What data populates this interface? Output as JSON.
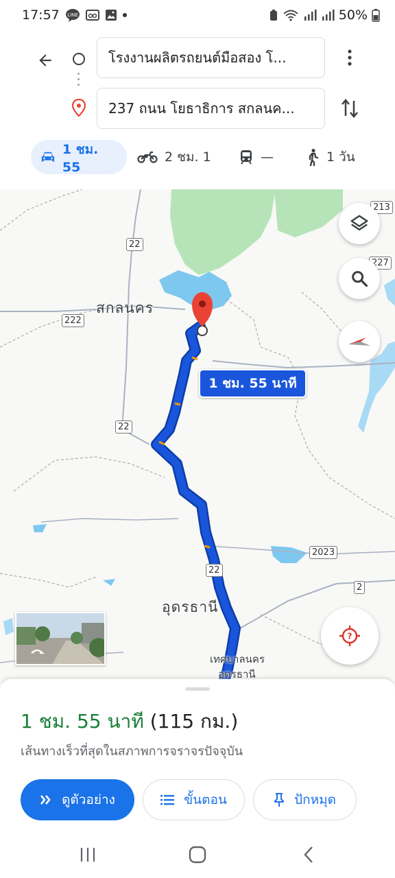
{
  "status_bar": {
    "time": "17:57",
    "battery": "50%",
    "icons": [
      "line-icon",
      "voicemail-icon",
      "gallery-icon",
      "wifi-icon",
      "signal-icon",
      "battery-icon"
    ]
  },
  "directions": {
    "origin": "โรงงานผลิตรถยนต์มือสอง โ...",
    "destination": "237 ถนน โยธาธิการ สกลนค...",
    "modes": [
      {
        "name": "car",
        "label": "1 ชม. 55",
        "active": true
      },
      {
        "name": "motorcycle",
        "label": "2 ชม. 1",
        "active": false
      },
      {
        "name": "transit",
        "label": "—",
        "active": false
      },
      {
        "name": "walk",
        "label": "1 วัน",
        "active": false
      }
    ]
  },
  "map": {
    "city_labels": {
      "sakon": "สกลนคร",
      "udon": "อุดรธานี",
      "municipality_line1": "เทศบาลนคร",
      "municipality_line2": "อุดรธานี"
    },
    "route_shields": [
      "22",
      "222",
      "22",
      "22",
      "2023",
      "2",
      "213",
      "227"
    ],
    "eta_bubble": "1 ชม. 55 นาที",
    "route_color": "#1a56db",
    "destination_pin_color": "#ea4335"
  },
  "sheet": {
    "duration": "1 ชม. 55 นาที",
    "distance": "(115 กม.)",
    "subtitle": "เส้นทางเร็วที่สุดในสภาพการจราจรปัจจุบัน",
    "buttons": {
      "preview": "ดูตัวอย่าง",
      "steps": "ขั้นตอน",
      "pin": "ปักหมุด"
    }
  },
  "colors": {
    "accent": "#1a73e8",
    "duration_green": "#188038",
    "active_mode_bg": "#e8f0fe"
  }
}
